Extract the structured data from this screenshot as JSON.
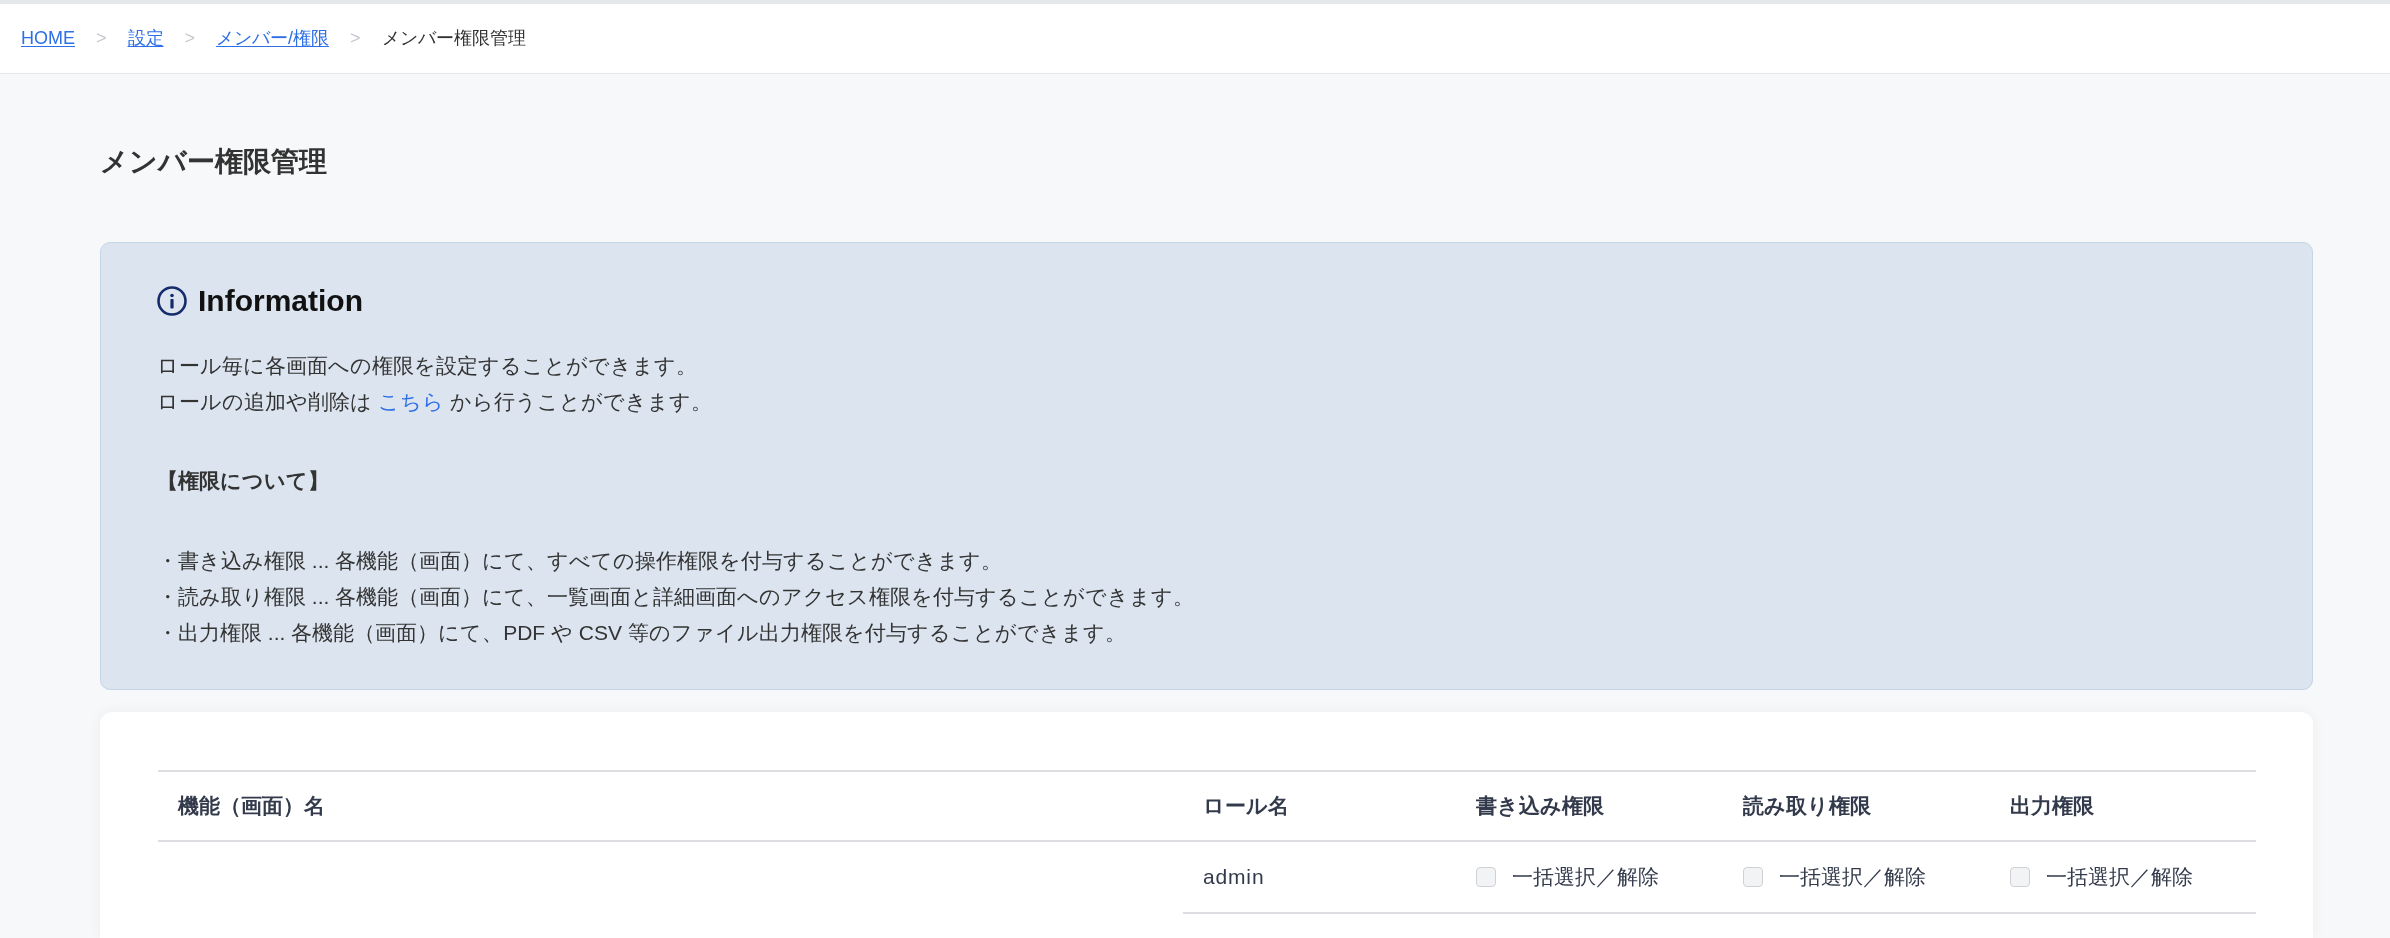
{
  "breadcrumb": [
    {
      "kind": "link",
      "label": "HOME"
    },
    {
      "kind": "separator",
      "label": ">"
    },
    {
      "kind": "link",
      "label": "設定"
    },
    {
      "kind": "separator",
      "label": ">"
    },
    {
      "kind": "link",
      "label": "メンバー/権限"
    },
    {
      "kind": "separator",
      "label": ">"
    },
    {
      "kind": "current",
      "label": "メンバー権限管理"
    }
  ],
  "page_title": "メンバー権限管理",
  "info": {
    "title": "Information",
    "lines": [
      {
        "kind": "text",
        "text": "ロール毎に各画面への権限を設定することができます。"
      },
      {
        "kind": "linked",
        "before": "ロールの追加や削除は ",
        "link": "こちら",
        "after": " から行うことができます。"
      },
      {
        "kind": "heading",
        "text": "【権限について】"
      },
      {
        "kind": "bullet",
        "text": "・書き込み権限 ... 各機能（画面）にて、すべての操作権限を付与することができます。"
      },
      {
        "kind": "bullet",
        "text": "・読み取り権限 ... 各機能（画面）にて、一覧画面と詳細画面へのアクセス権限を付与することができます。"
      },
      {
        "kind": "bullet",
        "text": "・出力権限 ... 各機能（画面）にて、PDF や CSV 等のファイル出力権限を付与することができます。"
      }
    ]
  },
  "table": {
    "columns": [
      "機能（画面）名",
      "ロール名",
      "書き込み権限",
      "読み取り権限",
      "出力権限"
    ],
    "rows": [
      {
        "role": "admin",
        "permissions": [
          {
            "label": "一括選択／解除",
            "checked": false
          },
          {
            "label": "一括選択／解除",
            "checked": false
          },
          {
            "label": "一括選択／解除",
            "checked": false
          }
        ]
      }
    ]
  }
}
